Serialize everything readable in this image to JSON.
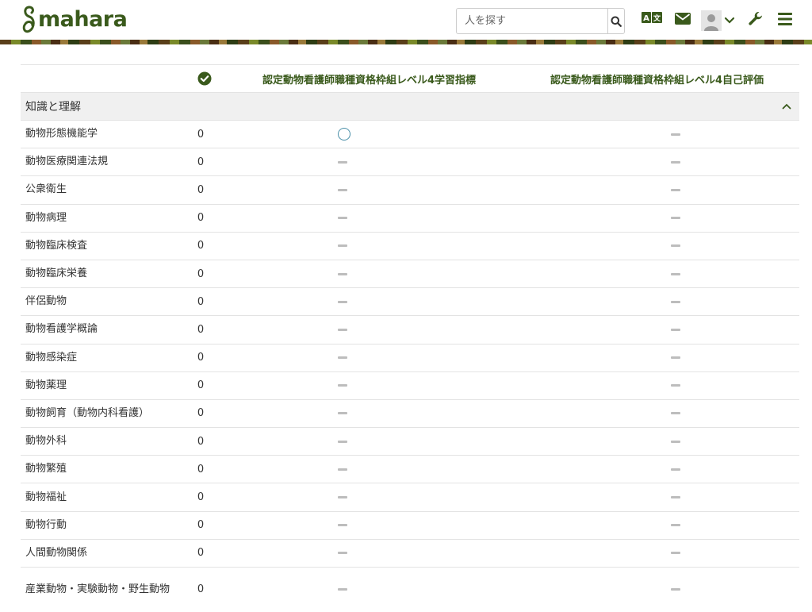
{
  "brand": {
    "name": "mahara",
    "color": "#3a5a1c"
  },
  "header": {
    "search_placeholder": "人を探す",
    "icons": [
      "search-icon",
      "language-icon",
      "envelope-icon",
      "user-icon",
      "chevron-down-icon",
      "wrench-icon",
      "menu-icon"
    ]
  },
  "matrix": {
    "columns": {
      "completed_icon": "check-circle-icon",
      "standard_a": "認定動物看護師職種資格枠組レベル4学習指標",
      "standard_b": "認定動物看護師職種資格枠組レベル4自己評価"
    },
    "group": {
      "title": "知識と理解",
      "toggle_icon": "chevron-up-icon"
    },
    "rows": [
      {
        "name": "動物形態機能学",
        "count": "0",
        "a": "ring",
        "b": "dash"
      },
      {
        "name": "動物医療関連法規",
        "count": "0",
        "a": "dash",
        "b": "dash"
      },
      {
        "name": "公衆衛生",
        "count": "0",
        "a": "dash",
        "b": "dash"
      },
      {
        "name": "動物病理",
        "count": "0",
        "a": "dash",
        "b": "dash"
      },
      {
        "name": "動物臨床検査",
        "count": "0",
        "a": "dash",
        "b": "dash"
      },
      {
        "name": "動物臨床栄養",
        "count": "0",
        "a": "dash",
        "b": "dash"
      },
      {
        "name": "伴侶動物",
        "count": "0",
        "a": "dash",
        "b": "dash"
      },
      {
        "name": "動物看護学概論",
        "count": "0",
        "a": "dash",
        "b": "dash"
      },
      {
        "name": "動物感染症",
        "count": "0",
        "a": "dash",
        "b": "dash"
      },
      {
        "name": "動物薬理",
        "count": "0",
        "a": "dash",
        "b": "dash"
      },
      {
        "name": "動物飼育（動物内科看護）",
        "count": "0",
        "a": "dash",
        "b": "dash"
      },
      {
        "name": "動物外科",
        "count": "0",
        "a": "dash",
        "b": "dash"
      },
      {
        "name": "動物繁殖",
        "count": "0",
        "a": "dash",
        "b": "dash"
      },
      {
        "name": "動物福祉",
        "count": "0",
        "a": "dash",
        "b": "dash"
      },
      {
        "name": "動物行動",
        "count": "0",
        "a": "dash",
        "b": "dash"
      },
      {
        "name": "人間動物関係",
        "count": "0",
        "a": "dash",
        "b": "dash"
      },
      {
        "name": "産業動物・実験動物・野生動物",
        "count": "0",
        "a": "dash",
        "b": "dash"
      }
    ]
  },
  "colors": {
    "accent": "#3a5a1c",
    "ring": "#4a8fa8",
    "dash": "#bdbdbd",
    "group_bg": "#f0f0f0"
  }
}
